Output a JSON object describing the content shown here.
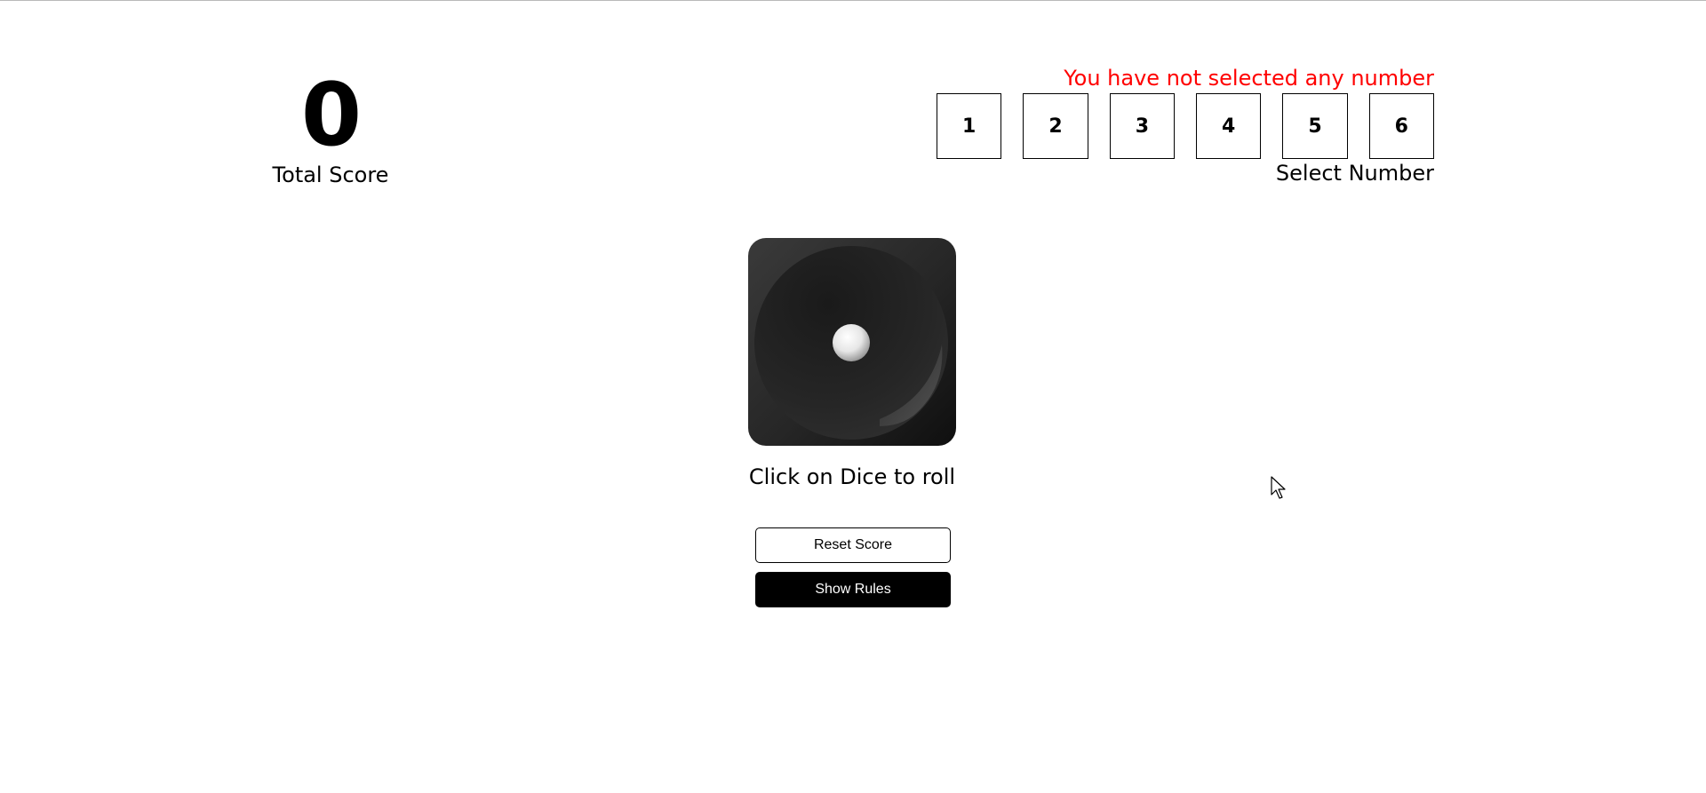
{
  "score": {
    "value": "0",
    "label": "Total Score"
  },
  "number_selector": {
    "error_message": "You have not selected any number",
    "options": [
      "1",
      "2",
      "3",
      "4",
      "5",
      "6"
    ],
    "label": "Select Number"
  },
  "dice": {
    "face_value": 1,
    "caption": "Click on Dice to roll"
  },
  "buttons": {
    "reset_label": "Reset Score",
    "rules_label": "Show Rules"
  },
  "colors": {
    "error": "#ff0000",
    "primary": "#000000",
    "background": "#ffffff"
  }
}
